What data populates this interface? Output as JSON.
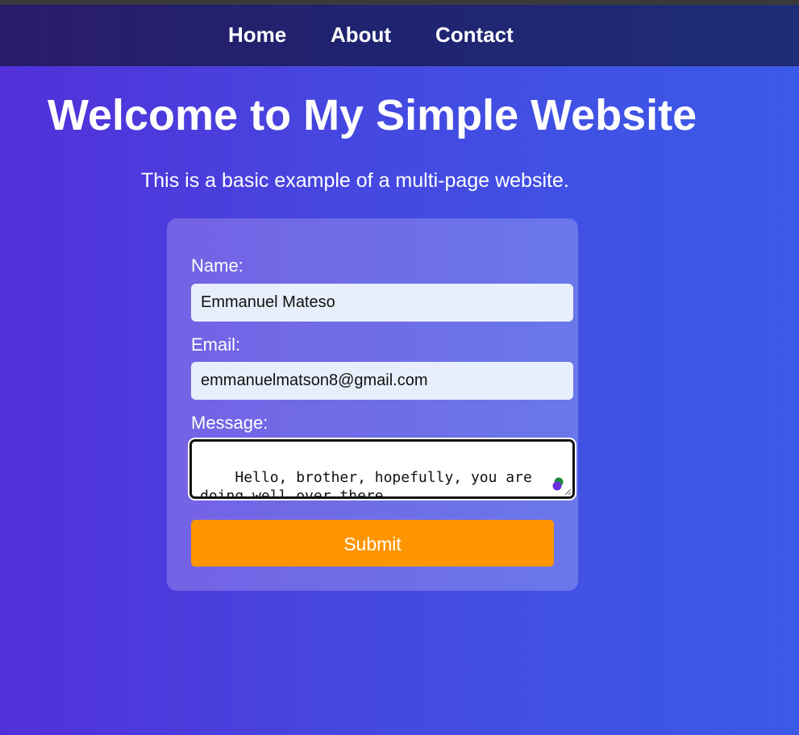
{
  "nav": {
    "items": [
      {
        "label": "Home"
      },
      {
        "label": "About"
      },
      {
        "label": "Contact"
      }
    ]
  },
  "header": {
    "title": "Welcome to My Simple Website",
    "subtitle": "This is a basic example of a multi-page website."
  },
  "form": {
    "name_label": "Name:",
    "name_value": "Emmanuel Mateso",
    "email_label": "Email:",
    "email_value": "emmanuelmatson8@gmail.com",
    "message_label": "Message:",
    "message_value": "Hello, brother, hopefully, you are doing well over there",
    "submit_label": "Submit"
  },
  "colors": {
    "accent": "#ff9500",
    "input_bg": "#e8effc",
    "nav_bg": "#1f2470"
  },
  "icons": {
    "textarea_extension": "grammar-check-icon",
    "textarea_resize": "resize-grip-icon"
  }
}
